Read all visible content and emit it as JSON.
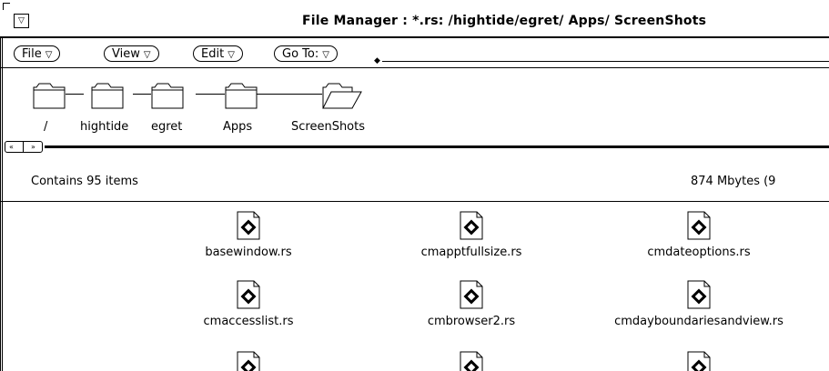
{
  "window": {
    "menu_glyph": "▽",
    "title": "File Manager  : *.rs: /hightide/egret/ Apps/ ScreenShots"
  },
  "menubar": {
    "buttons": [
      {
        "label": "File",
        "icon": "menu-triangle"
      },
      {
        "label": "View",
        "icon": "menu-triangle"
      },
      {
        "label": "Edit",
        "icon": "menu-triangle"
      },
      {
        "label": "Go To:",
        "icon": "menu-triangle"
      }
    ],
    "triangle_glyph": "▽",
    "goto_value": ""
  },
  "path": {
    "folders": [
      {
        "label": "/",
        "open": false
      },
      {
        "label": "hightide",
        "open": false
      },
      {
        "label": "egret",
        "open": false
      },
      {
        "label": "Apps",
        "open": false
      },
      {
        "label": "ScreenShots",
        "open": true
      }
    ]
  },
  "scrollbar": {
    "left_glyph": "«",
    "right_glyph": "»"
  },
  "status": {
    "items": "Contains 95 items",
    "space": "874 Mbytes (9"
  },
  "files": [
    {
      "name": "basewindow.rs"
    },
    {
      "name": "cmapptfullsize.rs"
    },
    {
      "name": "cmdateoptions.rs"
    },
    {
      "name": "cmaccesslist.rs"
    },
    {
      "name": "cmbrowser2.rs"
    },
    {
      "name": "cmdayboundariesandview.rs"
    },
    {
      "name": ""
    },
    {
      "name": ""
    },
    {
      "name": ""
    }
  ],
  "colors": {
    "foreground": "#000000",
    "background": "#ffffff"
  }
}
